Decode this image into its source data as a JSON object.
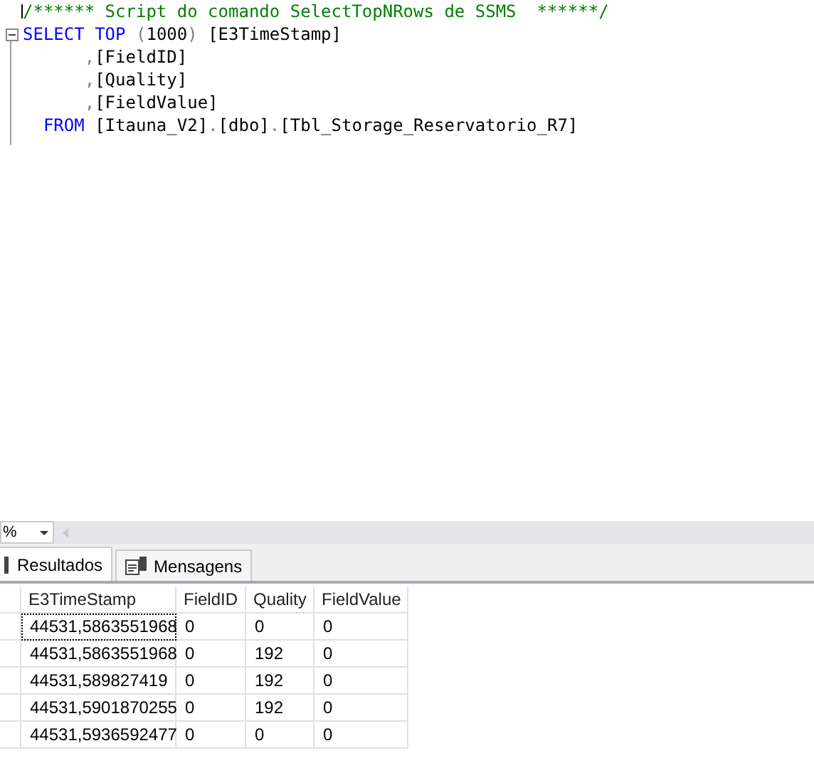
{
  "editor": {
    "lines": [
      {
        "kind": "comment",
        "foldable": false,
        "tokens": [
          {
            "kind": "comment",
            "text": "/****** Script do comando SelectTopNRows de SSMS  ******/"
          }
        ]
      },
      {
        "kind": "select",
        "foldable": true,
        "tokens": [
          {
            "kind": "keyword",
            "text": "SELECT"
          },
          {
            "kind": "keyword",
            "text": " TOP"
          },
          {
            "kind": "punct",
            "text": " ("
          },
          {
            "kind": "plain",
            "text": "1000"
          },
          {
            "kind": "punct",
            "text": ")"
          },
          {
            "kind": "plain",
            "text": " [E3TimeStamp]"
          }
        ]
      },
      {
        "kind": "column",
        "foldable": false,
        "tokens": [
          {
            "kind": "punct",
            "text": ","
          },
          {
            "kind": "plain",
            "text": "[FieldID]"
          }
        ]
      },
      {
        "kind": "column",
        "foldable": false,
        "tokens": [
          {
            "kind": "punct",
            "text": ","
          },
          {
            "kind": "plain",
            "text": "[Quality]"
          }
        ]
      },
      {
        "kind": "column",
        "foldable": false,
        "tokens": [
          {
            "kind": "punct",
            "text": ","
          },
          {
            "kind": "plain",
            "text": "[FieldValue]"
          }
        ]
      },
      {
        "kind": "from",
        "foldable": false,
        "tokens": [
          {
            "kind": "keyword",
            "text": "FROM"
          },
          {
            "kind": "plain",
            "text": " [Itauna_V2]"
          },
          {
            "kind": "punct",
            "text": "."
          },
          {
            "kind": "plain",
            "text": "[dbo]"
          },
          {
            "kind": "punct",
            "text": "."
          },
          {
            "kind": "plain",
            "text": "[Tbl_Storage_Reservatorio_R7]"
          }
        ]
      }
    ]
  },
  "zoom": {
    "value": "%"
  },
  "tabs": [
    {
      "label": "Resultados",
      "selected": true
    },
    {
      "label": "Mensagens",
      "selected": false
    }
  ],
  "table": {
    "columns": [
      "E3TimeStamp",
      "FieldID",
      "Quality",
      "FieldValue"
    ],
    "rows": [
      {
        "selected": true,
        "cells": [
          "44531,5863551968",
          "0",
          "0",
          "0"
        ]
      },
      {
        "selected": false,
        "cells": [
          "44531,5863551968",
          "0",
          "192",
          "0"
        ]
      },
      {
        "selected": false,
        "cells": [
          "44531,589827419",
          "0",
          "192",
          "0"
        ]
      },
      {
        "selected": false,
        "cells": [
          "44531,5901870255",
          "0",
          "192",
          "0"
        ]
      },
      {
        "selected": false,
        "cells": [
          "44531,5936592477",
          "0",
          "0",
          "0"
        ]
      }
    ]
  }
}
